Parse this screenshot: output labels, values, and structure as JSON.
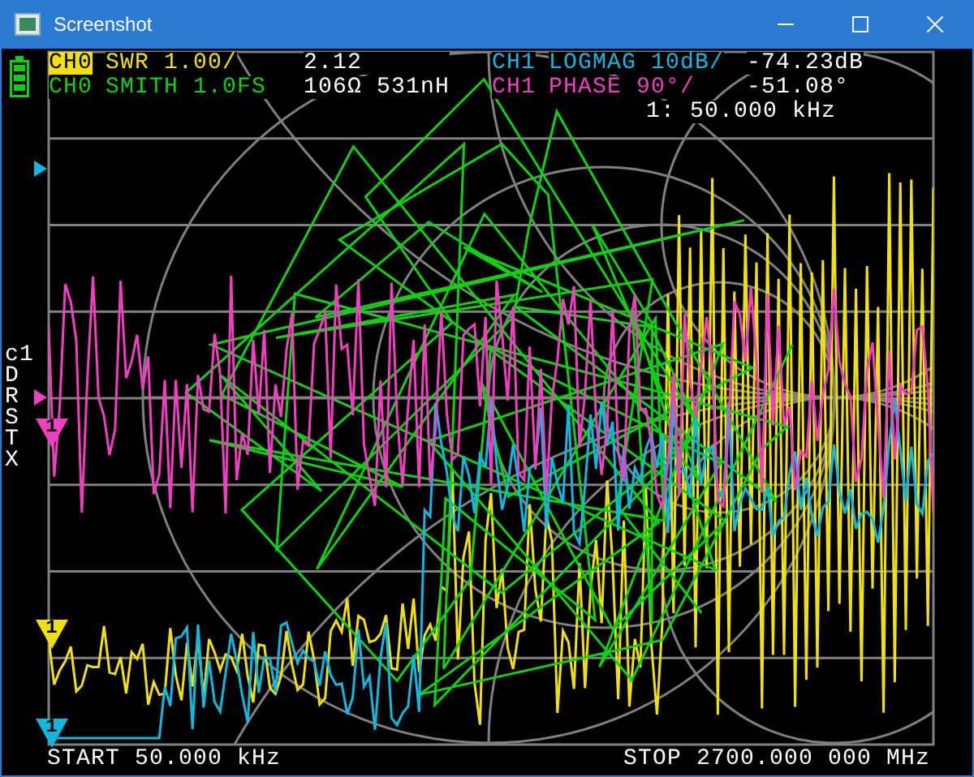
{
  "window": {
    "title": "Screenshot"
  },
  "traces": [
    {
      "channel": "CH0",
      "format": "SWR 1.00/",
      "reading": "2.12",
      "color": "#f0e010",
      "selected": true
    },
    {
      "channel": "CH0",
      "format": "SMITH 1.0FS",
      "reading": "106Ω 531nH",
      "color": "#10d010",
      "selected": false
    },
    {
      "channel": "CH1",
      "format": "LOGMAG 10dB/",
      "reading": "-74.23dB",
      "color": "#10b8e0",
      "selected": false
    },
    {
      "channel": "CH1",
      "format": "PHASE 90°/",
      "reading": "-51.08°",
      "color": "#f040c0",
      "selected": false
    }
  ],
  "marker_readout": "1: 50.000 kHz",
  "cal_status": [
    "c1",
    "D",
    "R",
    "S",
    "T",
    "X"
  ],
  "markers": [
    {
      "label": "1",
      "color": "#f040c0"
    },
    {
      "label": "1",
      "color": "#f0e010"
    },
    {
      "label": "1",
      "color": "#10b8e0"
    }
  ],
  "start": "START 50.000 kHz",
  "stop": "STOP 2700.000 000 MHz"
}
